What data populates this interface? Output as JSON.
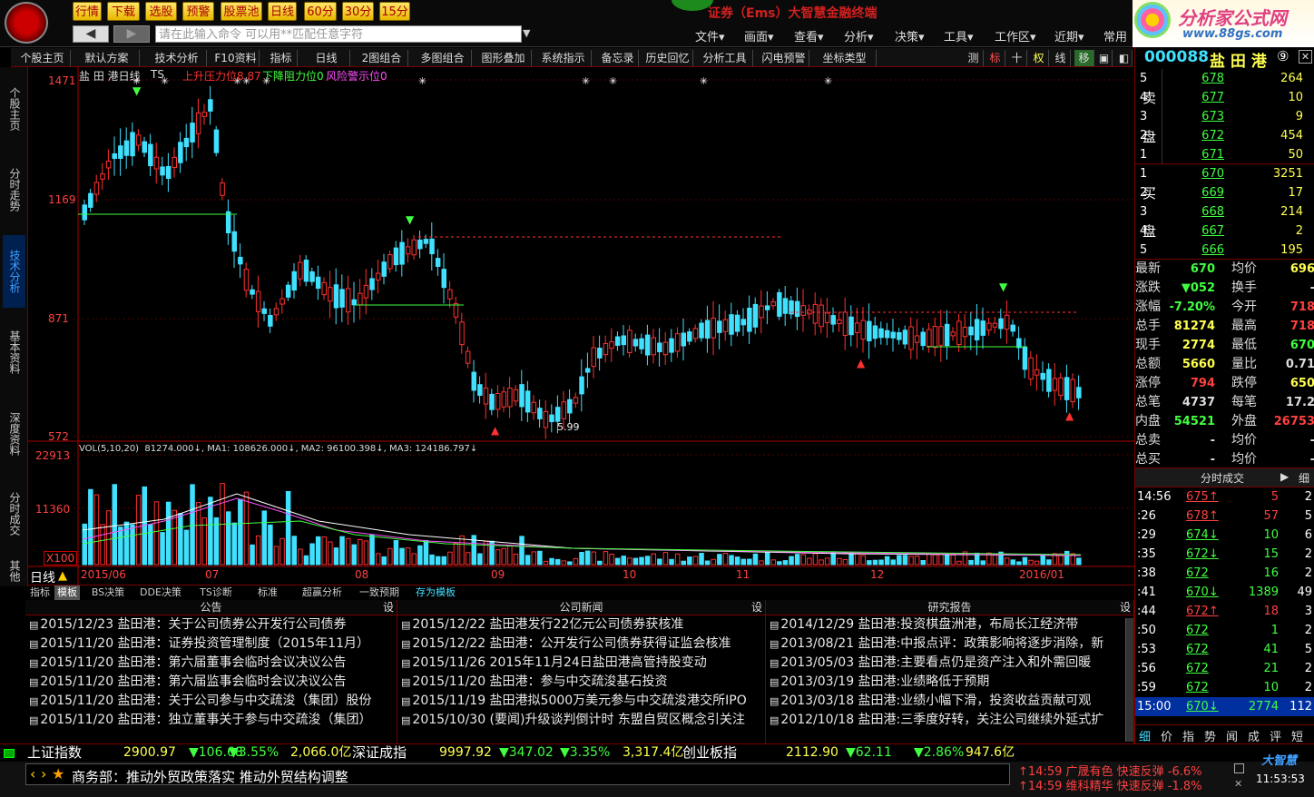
{
  "toolbar": {
    "buttons": [
      "行情",
      "下载",
      "选股",
      "预警",
      "股票池",
      "日线",
      "60分",
      "30分",
      "15分"
    ],
    "command_placeholder": "请在此输入命令   可以用**匹配任意字符",
    "menus": [
      "文件▾",
      "画面▾",
      "查看▾",
      "分析▾",
      "决策▾",
      "工具▾",
      "工作区▾",
      "近期▾",
      "常用"
    ],
    "app_title": "证券（Ems）大智慧金融终端"
  },
  "brand": {
    "name": "分析家公式网",
    "url": "www.88gs.com"
  },
  "tabs": [
    "个股主页",
    "默认方案",
    "技术分析",
    "F10资料",
    "指标",
    "日线",
    "2图组合",
    "多图组合",
    "图形叠加",
    "系统指示",
    "备忘录",
    "历史回忆",
    "分析工具",
    "闪电预警",
    "坐标类型"
  ],
  "tool_icons": [
    "测",
    "标",
    "十",
    "权",
    "线",
    "移"
  ],
  "left_rail": [
    "个股主页",
    "分时走势",
    "技术分析",
    "基本资料",
    "深度资料",
    "分时成交",
    "其他"
  ],
  "chart": {
    "stock_label": "盐 田 港日线",
    "ts": "TS",
    "ind1": "上升压力位8.87",
    "ind2": "下降阻力位0",
    "ind3": "风险警示位0",
    "price_ticks": [
      "1471",
      "1169",
      "871",
      "572"
    ],
    "vol_ticks": [
      "22913",
      "11360",
      "X100"
    ],
    "vol_legend": "VOL(5,10,20)  81274.000↓, MA1: 108626.000↓, MA2: 96100.398↓, MA3: 124186.797↓",
    "low_label": "5.99",
    "period": "日线",
    "dates": [
      "2015/06",
      "07",
      "08",
      "09",
      "10",
      "11",
      "12",
      "2016/01"
    ]
  },
  "bottom_tabs": [
    "指标",
    "模板",
    "BS决策",
    "DDE决策",
    "TS诊断",
    "标准",
    "超赢分析",
    "一致预期",
    "存为模板"
  ],
  "news": {
    "headers": [
      "公告",
      "公司新闻",
      "研究报告"
    ],
    "set_label": "设",
    "announcements": [
      "2015/12/23  盐田港：关于公司债券公开发行公司债券",
      "2015/11/20  盐田港：证券投资管理制度（2015年11月）",
      "2015/11/20  盐田港：第六届董事会临时会议决议公告",
      "2015/11/20  盐田港：第六届监事会临时会议决议公告",
      "2015/11/20  盐田港：关于公司参与中交疏浚（集团）股份",
      "2015/11/20  盐田港：独立董事关于参与中交疏浚（集团）"
    ],
    "company": [
      "2015/12/22  盐田港发行22亿元公司债券获核准",
      "2015/12/22  盐田港：公开发行公司债券获得证监会核准",
      "2015/11/26  2015年11月24日盐田港高管持股变动",
      "2015/11/20  盐田港：参与中交疏浚基石投资",
      "2015/11/19  盐田港拟5000万美元参与中交疏浚港交所IPO",
      "2015/10/30  (要闻)升级谈判倒计时 东盟自贸区概念引关注"
    ],
    "research": [
      "2014/12/29  盐田港:投资棋盘洲港，布局长江经济带",
      "2013/08/21  盐田港:中报点评：政策影响将逐步消除，新",
      "2013/05/03  盐田港:主要看点仍是资产注入和外需回暖",
      "2013/03/19  盐田港:业绩略低于预期",
      "2013/03/18  盐田港:业绩小幅下滑，投资收益贡献可观",
      "2012/10/18  盐田港:三季度好转，关注公司继续外延式扩"
    ]
  },
  "quote": {
    "code": "000088",
    "name": "盐 田 港",
    "badge": "⑨",
    "sell_label": [
      "卖",
      "盘"
    ],
    "buy_label": [
      "买",
      "盘"
    ],
    "sell": [
      [
        "5",
        "678",
        "264"
      ],
      [
        "4",
        "677",
        "10"
      ],
      [
        "3",
        "673",
        "9"
      ],
      [
        "2",
        "672",
        "454"
      ],
      [
        "1",
        "671",
        "50"
      ]
    ],
    "buy": [
      [
        "1",
        "670",
        "3251"
      ],
      [
        "2",
        "669",
        "17"
      ],
      [
        "3",
        "668",
        "214"
      ],
      [
        "4",
        "667",
        "2"
      ],
      [
        "5",
        "666",
        "195"
      ]
    ],
    "stats": [
      [
        "最新",
        "670",
        "均价",
        "696"
      ],
      [
        "涨跌",
        "▼052",
        "换手",
        "-"
      ],
      [
        "涨幅",
        "-7.20%",
        "今开",
        "718"
      ],
      [
        "总手",
        "81274",
        "最高",
        "718"
      ],
      [
        "现手",
        "2774",
        "最低",
        "670"
      ],
      [
        "总额",
        "5660",
        "量比",
        "0.71"
      ],
      [
        "涨停",
        "794",
        "跌停",
        "650"
      ],
      [
        "总笔",
        "4737",
        "每笔",
        "17.2"
      ],
      [
        "内盘",
        "54521",
        "外盘",
        "26753"
      ],
      [
        "总卖",
        "-",
        "均价",
        "-"
      ],
      [
        "总买",
        "-",
        "均价",
        "-"
      ]
    ],
    "ticks_title": "分时成交",
    "ticks_more": "细",
    "ticks": [
      [
        "14:56",
        "675↑",
        "5",
        "2"
      ],
      [
        ":26",
        "678↑",
        "57",
        "5"
      ],
      [
        ":29",
        "674↓",
        "10",
        "6"
      ],
      [
        ":35",
        "672↓",
        "15",
        "2"
      ],
      [
        ":38",
        "672",
        "16",
        "2"
      ],
      [
        ":41",
        "670↓",
        "1389",
        "49"
      ],
      [
        ":44",
        "672↑",
        "18",
        "3"
      ],
      [
        ":50",
        "672",
        "1",
        "2"
      ],
      [
        ":53",
        "672",
        "41",
        "5"
      ],
      [
        ":56",
        "672",
        "21",
        "2"
      ],
      [
        ":59",
        "672",
        "10",
        "2"
      ],
      [
        "15:00",
        "670↓",
        "2774",
        "112"
      ]
    ],
    "bottom_tabs": [
      "细",
      "价",
      "指",
      "势",
      "闻",
      "成",
      "评",
      "短"
    ]
  },
  "ticker": {
    "items": [
      "上证指数",
      "2900.97",
      "▼106.68",
      "▼3.55%",
      "2,066.0亿",
      "深证成指",
      "9997.92",
      "▼347.02",
      "▼3.35%",
      "3,317.4亿",
      "创业板指",
      "2112.90",
      "▼62.11",
      "▼2.86%",
      "947.6亿"
    ]
  },
  "status": {
    "marquee": "商务部：推动外贸政策落实 推动外贸结构调整",
    "alerts": [
      "↑14:59 广晟有色 快速反弹 -6.6%",
      "↑14:59 维科精华 快速反弹 -1.8%"
    ],
    "logo": "大智慧",
    "clock": "11:53:53"
  }
}
